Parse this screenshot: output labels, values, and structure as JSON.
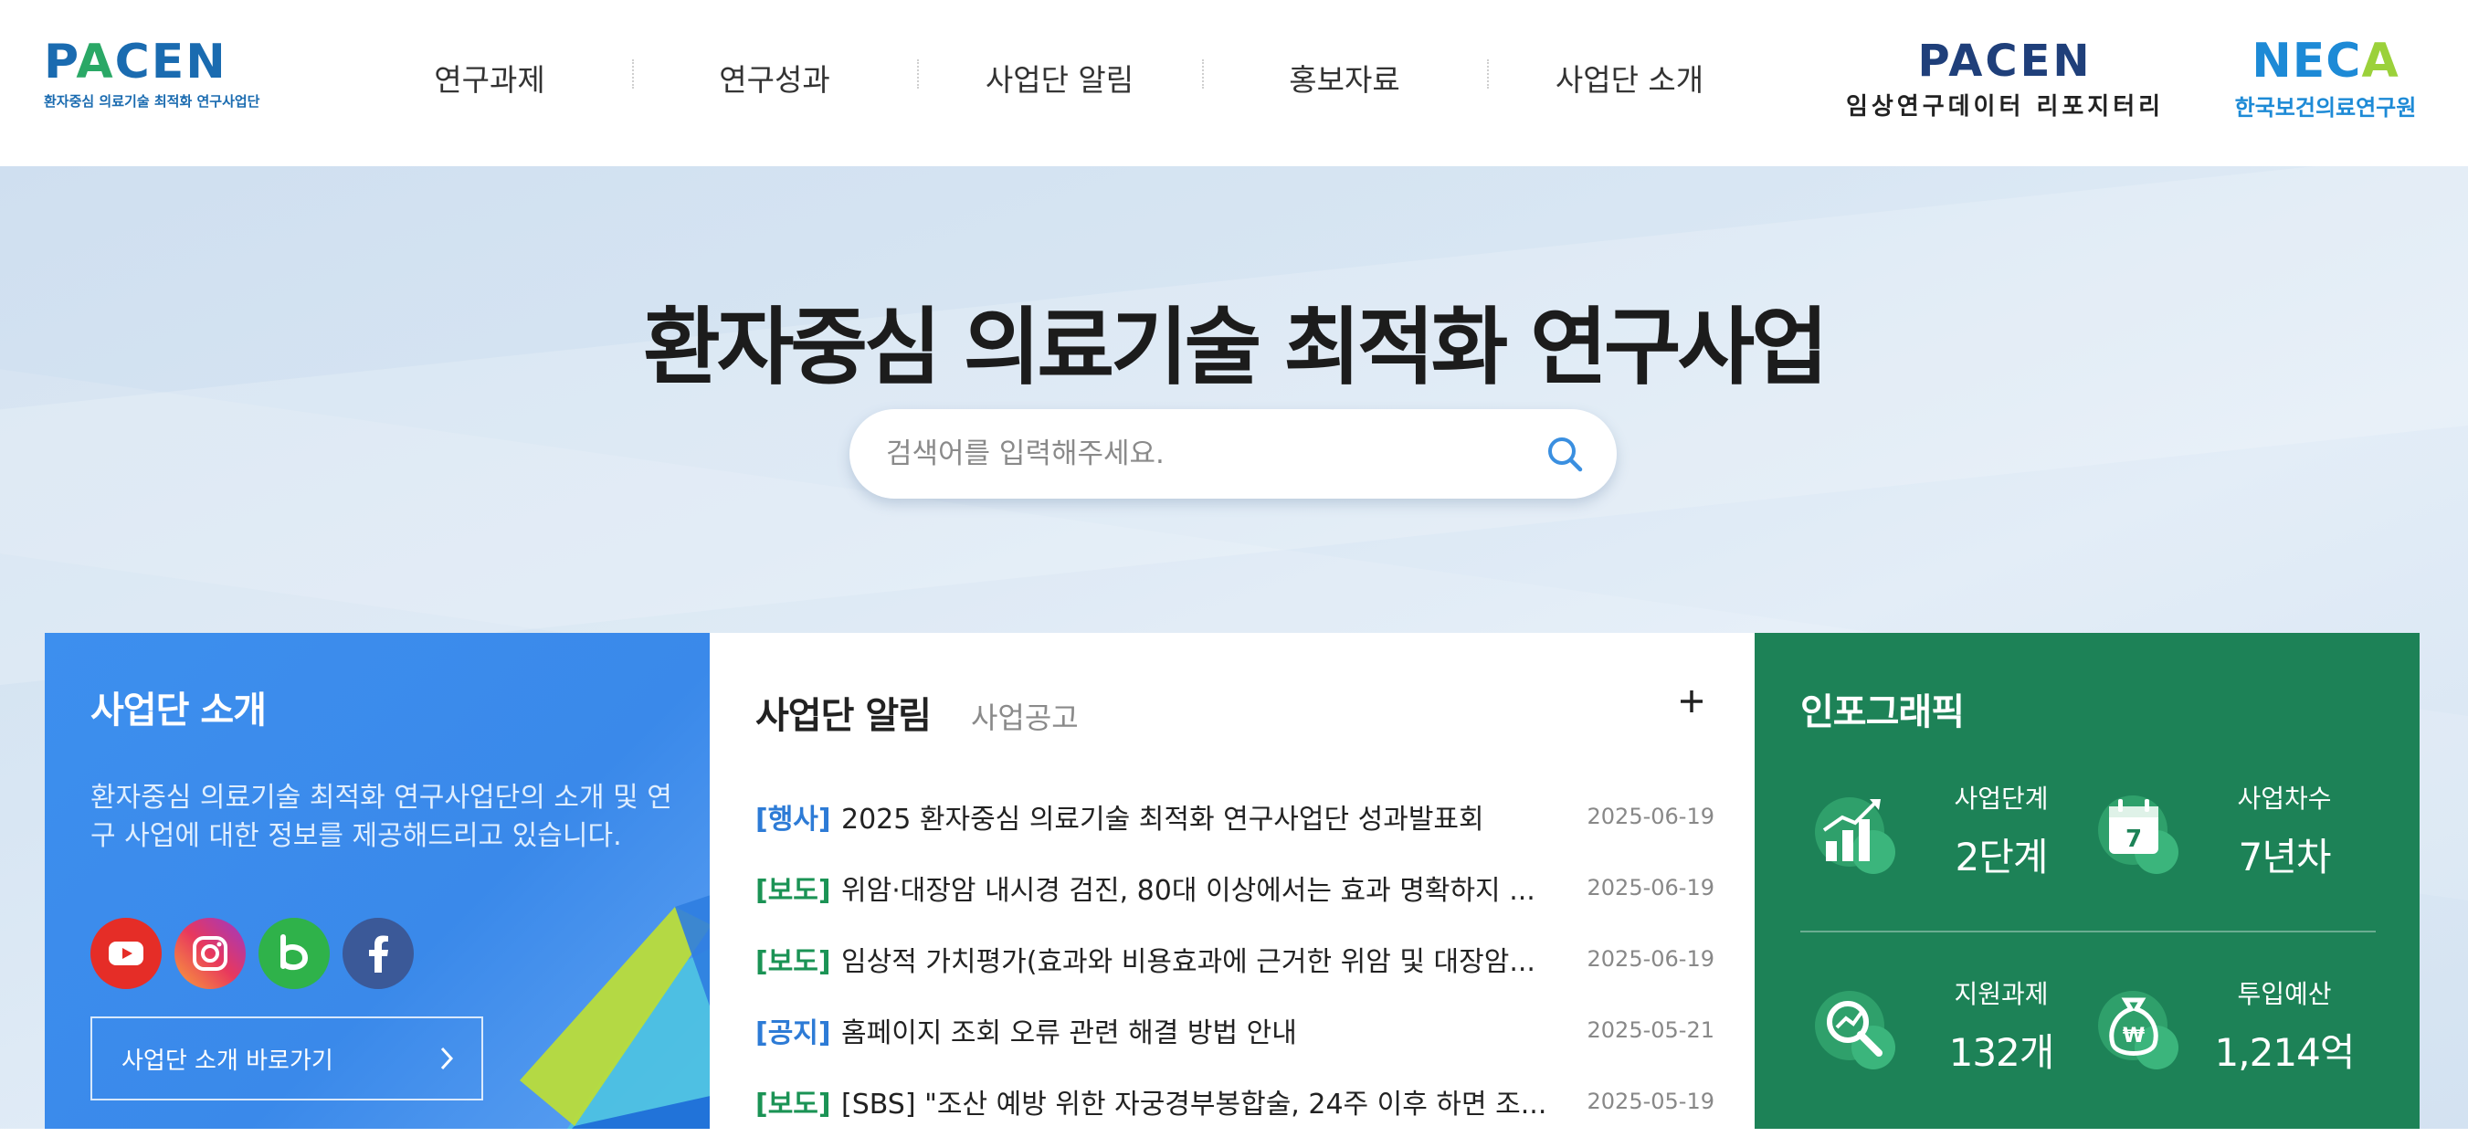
{
  "header": {
    "logo_main": {
      "word_pre": "P",
      "word_a": "A",
      "word_post": "CEN",
      "subtitle": "환자중심 의료기술 최적화 연구사업단"
    },
    "nav": [
      "연구과제",
      "연구성과",
      "사업단 알림",
      "홍보자료",
      "사업단 소개"
    ],
    "logo_repo": {
      "word": "PACEN",
      "subtitle": "임상연구데이터 리포지터리"
    },
    "logo_neca": {
      "word_pre": "NEC",
      "word_a": "A",
      "subtitle": "한국보건의료연구원"
    }
  },
  "hero": {
    "title": "환자중심 의료기술 최적화 연구사업",
    "search_placeholder": "검색어를 입력해주세요.",
    "search_value": ""
  },
  "intro": {
    "title": "사업단 소개",
    "description": "환자중심 의료기술 최적화 연구사업단의 소개 및 연구 사업에 대한 정보를 제공해드리고 있습니다.",
    "sns": [
      "youtube-icon",
      "instagram-icon",
      "blog-icon",
      "facebook-icon"
    ],
    "link_label": "사업단 소개 바로가기"
  },
  "news": {
    "tabs": [
      {
        "label": "사업단 알림",
        "active": true
      },
      {
        "label": "사업공고",
        "active": false
      }
    ],
    "more_label": "+",
    "items": [
      {
        "tag": "[행사]",
        "tag_color": "#2d7bd6",
        "text": "2025 환자중심 의료기술 최적화 연구사업단 성과발표회",
        "date": "2025-06-19"
      },
      {
        "tag": "[보도]",
        "tag_color": "#1b9355",
        "text": "위암·대장암 내시경 검진, 80대 이상에서는 효과 명확하지 ...",
        "date": "2025-06-19"
      },
      {
        "tag": "[보도]",
        "tag_color": "#1b9355",
        "text": "임상적 가치평가(효과와 비용효과에 근거한 위암 및 대장암...",
        "date": "2025-06-19"
      },
      {
        "tag": "[공지]",
        "tag_color": "#2d7bd6",
        "text": "홈페이지 조회 오류 관련 해결 방법 안내",
        "date": "2025-05-21"
      },
      {
        "tag": "[보도]",
        "tag_color": "#1b9355",
        "text": "[SBS] \"조산 예방 위한 자궁경부봉합술, 24주 이후 하면 조...",
        "date": "2025-05-19"
      }
    ]
  },
  "infographic": {
    "title": "인포그래픽",
    "cells": [
      {
        "icon": "growth-chart-icon",
        "label": "사업단계",
        "value": "2단계"
      },
      {
        "icon": "calendar-icon",
        "label": "사업차수",
        "value": "7년차"
      },
      {
        "icon": "research-magnifier-icon",
        "label": "지원과제",
        "value": "132개"
      },
      {
        "icon": "money-bag-icon",
        "label": "투입예산",
        "value": "1,214억"
      }
    ]
  },
  "colors": {
    "primary_blue": "#3d8fee",
    "primary_green": "#1d8257",
    "accent_blue": "#2d7bd6"
  }
}
